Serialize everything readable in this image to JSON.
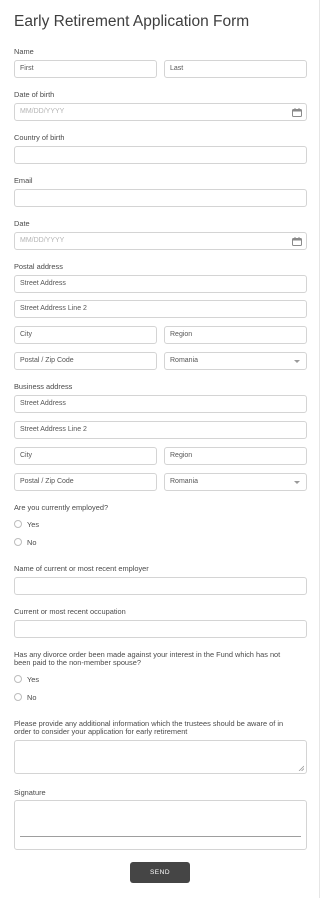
{
  "form": {
    "title": "Early Retirement Application Form",
    "name": {
      "label": "Name",
      "first_placeholder": "First",
      "last_placeholder": "Last"
    },
    "dob": {
      "label": "Date of birth",
      "placeholder": "MM/DD/YYYY",
      "icon": "calendar-icon"
    },
    "country_of_birth": {
      "label": "Country of birth",
      "value": ""
    },
    "email": {
      "label": "Email",
      "value": ""
    },
    "date": {
      "label": "Date",
      "placeholder": "MM/DD/YYYY",
      "icon": "calendar-icon"
    },
    "postal_address": {
      "label": "Postal address",
      "street": "Street Address",
      "street2": "Street Address Line 2",
      "city": "City",
      "region": "Region",
      "zip": "Postal / Zip Code",
      "country": "Romania"
    },
    "business_address": {
      "label": "Business address",
      "street": "Street Address",
      "street2": "Street Address Line 2",
      "city": "City",
      "region": "Region",
      "zip": "Postal / Zip Code",
      "country": "Romania"
    },
    "employed": {
      "question": "Are you currently employed?",
      "options": [
        "Yes",
        "No"
      ]
    },
    "employer": {
      "label": "Name of current or most recent employer",
      "value": ""
    },
    "occupation": {
      "label": "Current or most recent occupation",
      "value": ""
    },
    "divorce": {
      "question_line1": "Has any divorce order been made against your interest in the Fund which has not",
      "question_line2": "been paid to the non-member spouse?",
      "options": [
        "Yes",
        "No"
      ]
    },
    "additional": {
      "label_line1": "Please provide any additional information which the trustees should be aware of in",
      "label_line2": "order to consider your application for early retirement",
      "value": ""
    },
    "signature": {
      "label": "Signature"
    },
    "submit_label": "SEND"
  },
  "colors": {
    "button": "#454545",
    "border": "#d4d4d4",
    "text": "#4a4a4a"
  }
}
